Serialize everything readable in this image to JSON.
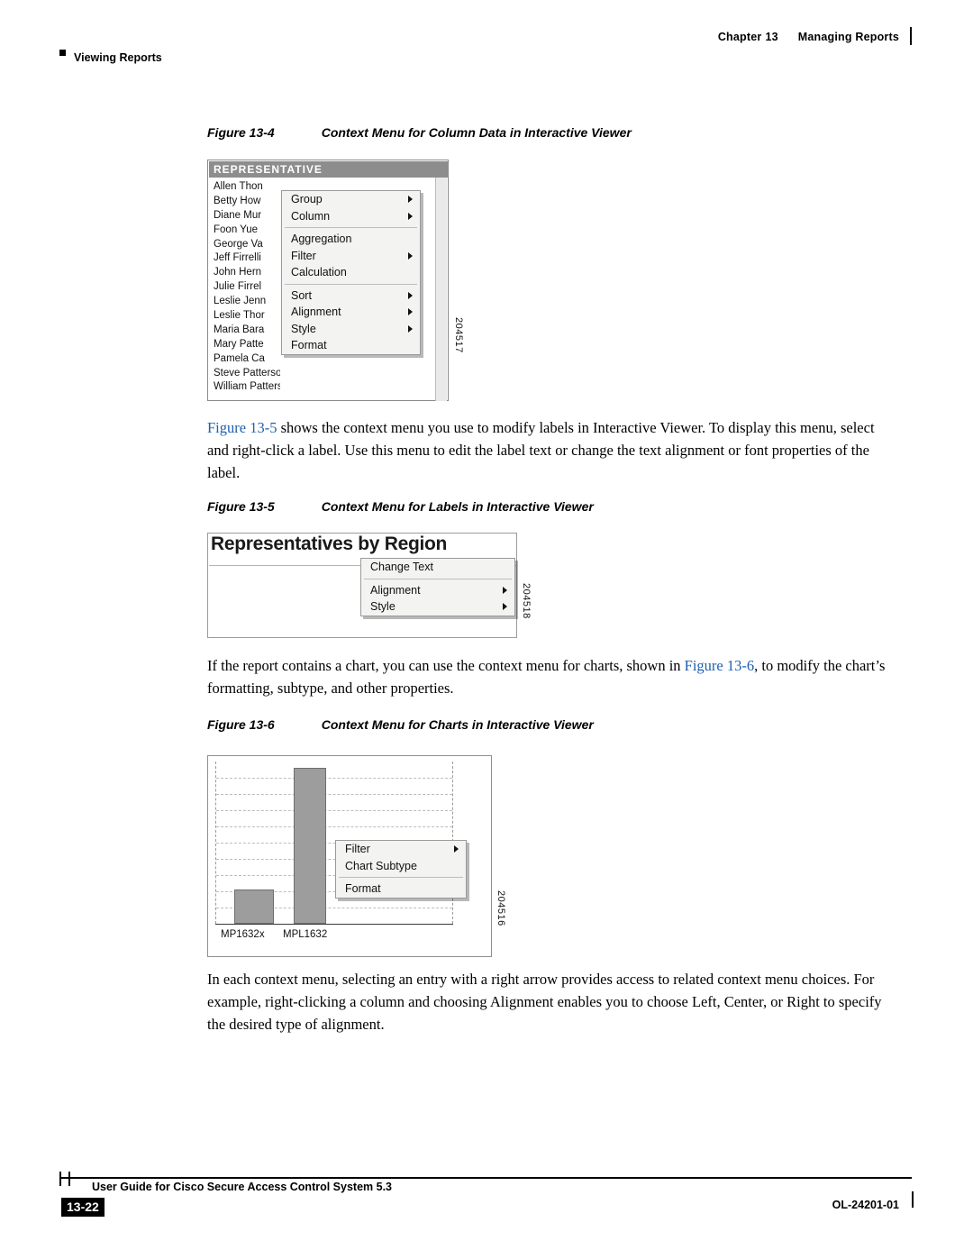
{
  "header": {
    "chapter_label": "Chapter",
    "chapter_number": "13",
    "chapter_title": "Managing Reports",
    "section": "Viewing Reports"
  },
  "figures": {
    "fig4": {
      "label": "Figure 13-4",
      "title": "Context Menu for Column Data in Interactive Viewer",
      "window_title": "REPRESENTATIVE",
      "names": [
        "Allen Thon",
        "Betty How",
        "Diane Mur",
        "Foon Yue ",
        "George Va",
        "Jeff Firrelli",
        "John Hern",
        "Julie Firrel",
        "Leslie Jenn",
        "Leslie Thor",
        "Maria Bara",
        "Mary Patte",
        "Pamela Ca",
        "Steve Patterson",
        "William Patterson"
      ],
      "menu": [
        {
          "label": "Group",
          "arrow": true
        },
        {
          "label": "Column",
          "arrow": true
        },
        {
          "separator": true
        },
        {
          "label": "Aggregation",
          "arrow": false
        },
        {
          "label": "Filter",
          "arrow": true
        },
        {
          "label": "Calculation",
          "arrow": false
        },
        {
          "separator": true
        },
        {
          "label": "Sort",
          "arrow": true
        },
        {
          "label": "Alignment",
          "arrow": true
        },
        {
          "label": "Style",
          "arrow": true
        },
        {
          "label": "Format",
          "arrow": false
        }
      ],
      "side_code": "204517"
    },
    "fig5": {
      "label": "Figure 13-5",
      "title": "Context Menu for Labels in Interactive Viewer",
      "heading": "Representatives by Region",
      "menu": [
        {
          "label": "Change Text",
          "arrow": false
        },
        {
          "separator": true
        },
        {
          "label": "Alignment",
          "arrow": true
        },
        {
          "label": "Style",
          "arrow": true
        }
      ],
      "side_code": "204518"
    },
    "fig6": {
      "label": "Figure 13-6",
      "title": "Context Menu for Charts in Interactive Viewer",
      "menu": [
        {
          "label": "Filter",
          "arrow": true
        },
        {
          "label": "Chart Subtype",
          "arrow": false
        },
        {
          "separator": true
        },
        {
          "label": "Format",
          "arrow": false
        }
      ],
      "x_labels": [
        "MP1632x",
        "MPL1632"
      ],
      "side_code": "204516"
    }
  },
  "body": {
    "para1_a": "Figure 13-5",
    "para1_b": " shows the context menu you use to modify labels in Interactive Viewer. To display this menu, select and right-click a label. Use this menu to edit the label text or change the text alignment or font properties of the label.",
    "para2_a": "If the report contains a chart, you can use the context menu for charts, shown in ",
    "para2_link": "Figure 13-6",
    "para2_b": ", to modify the chart’s formatting, subtype, and other properties.",
    "para3": "In each context menu, selecting an entry with a right arrow provides access to related context menu choices. For example, right-clicking a column and choosing Alignment enables you to choose Left, Center, or Right to specify the desired type of alignment."
  },
  "footer": {
    "guide_title": "User Guide for Cisco Secure Access Control System 5.3",
    "page_number": "13-22",
    "doc_id": "OL-24201-01"
  }
}
